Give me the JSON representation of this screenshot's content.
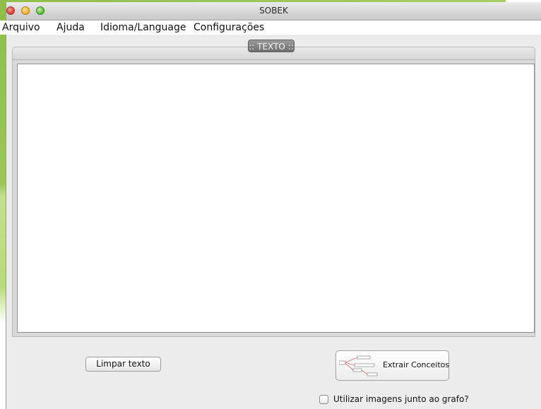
{
  "window": {
    "title": "SOBEK"
  },
  "menu": {
    "items": [
      "Arquivo",
      "Ajuda",
      "Idioma/Language",
      "Configurações"
    ]
  },
  "tab": {
    "label": ":: TEXTO ::"
  },
  "editor": {
    "value": ""
  },
  "buttons": {
    "clear_label": "Limpar texto",
    "extract_label": "Extrair Conceitos"
  },
  "options": {
    "use_images_label": "Utilizar imagens junto ao grafo?",
    "use_images_checked": false
  },
  "icons": {
    "close": "close-dot",
    "minimize": "minimize-dot",
    "maximize": "zoom-dot",
    "extract": "concept-graph-thumbnail-icon"
  }
}
